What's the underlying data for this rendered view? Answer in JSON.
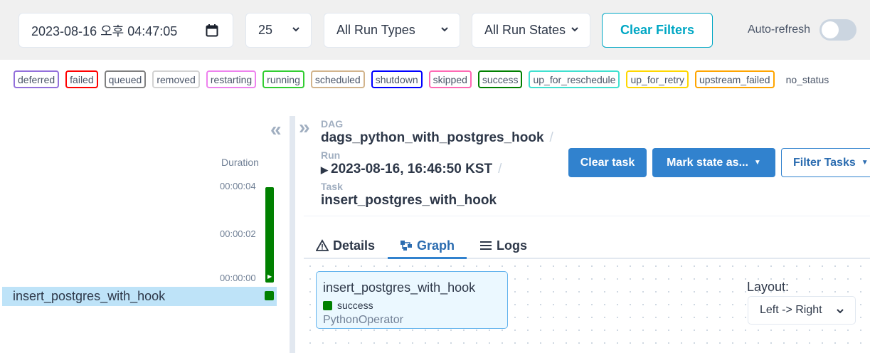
{
  "filters": {
    "date_value": "2023-08-16 오후 04:47:05",
    "num_runs": "25",
    "run_types": "All Run Types",
    "run_states": "All Run States",
    "clear_label": "Clear Filters",
    "autorefresh_label": "Auto-refresh",
    "autorefresh_on": false
  },
  "legend": [
    {
      "label": "deferred",
      "color": "#9370db"
    },
    {
      "label": "failed",
      "color": "#ff0000"
    },
    {
      "label": "queued",
      "color": "#808080"
    },
    {
      "label": "removed",
      "color": "#d3d3d3"
    },
    {
      "label": "restarting",
      "color": "#ee82ee"
    },
    {
      "label": "running",
      "color": "#32cd32"
    },
    {
      "label": "scheduled",
      "color": "#d2b48c"
    },
    {
      "label": "shutdown",
      "color": "#0000ff"
    },
    {
      "label": "skipped",
      "color": "#ff69b4"
    },
    {
      "label": "success",
      "color": "#008000"
    },
    {
      "label": "up_for_reschedule",
      "color": "#40e0d0"
    },
    {
      "label": "up_for_retry",
      "color": "#ffd700"
    },
    {
      "label": "upstream_failed",
      "color": "#ffa500"
    },
    {
      "label": "no_status",
      "color": "transparent"
    }
  ],
  "grid": {
    "duration_header": "Duration",
    "ticks": [
      "00:00:04",
      "00:00:02",
      "00:00:00"
    ],
    "task_name": "insert_postgres_with_hook",
    "run_duration_fraction": 1.0
  },
  "breadcrumb": {
    "dag_label": "DAG",
    "dag_value": "dags_python_with_postgres_hook",
    "run_label": "Run",
    "run_value": "2023-08-16, 16:46:50 KST",
    "task_label": "Task",
    "task_value": "insert_postgres_with_hook"
  },
  "actions": {
    "clear_task": "Clear task",
    "mark_state": "Mark state as...",
    "filter_tasks": "Filter Tasks"
  },
  "tabs": {
    "details": "Details",
    "graph": "Graph",
    "logs": "Logs",
    "active": "graph"
  },
  "graph": {
    "node_title": "insert_postgres_with_hook",
    "node_status": "success",
    "node_operator": "PythonOperator",
    "layout_label": "Layout:",
    "layout_value": "Left -> Right"
  }
}
